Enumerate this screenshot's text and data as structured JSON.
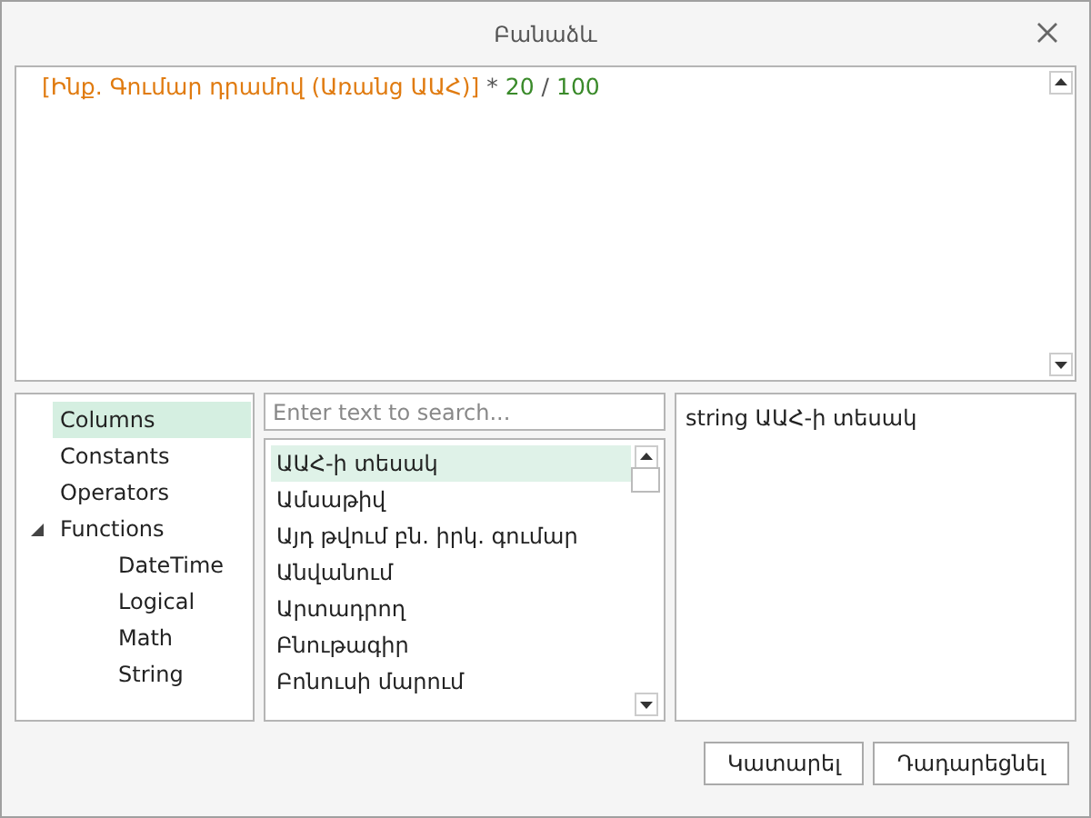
{
  "window": {
    "title": "Բանաձև"
  },
  "expression": [
    {
      "kind": "field",
      "text": "[Ինք. Գումար դրամով (Առանց ԱԱՀ)]"
    },
    {
      "kind": "operator",
      "text": "*"
    },
    {
      "kind": "number",
      "text": "20"
    },
    {
      "kind": "operator",
      "text": "/"
    },
    {
      "kind": "number",
      "text": "100"
    }
  ],
  "categories": [
    {
      "label": "Columns",
      "selected": true
    },
    {
      "label": "Constants",
      "selected": false
    },
    {
      "label": "Operators",
      "selected": false
    },
    {
      "label": "Functions",
      "selected": false,
      "expanded": true,
      "children": [
        {
          "label": "DateTime",
          "selected": false
        },
        {
          "label": "Logical",
          "selected": false
        },
        {
          "label": "Math",
          "selected": false
        },
        {
          "label": "String",
          "selected": false
        }
      ]
    }
  ],
  "search": {
    "placeholder": "Enter text to search..."
  },
  "items": [
    {
      "label": "ԱԱՀ-ի տեսակ",
      "selected": true
    },
    {
      "label": "Ամսաթիվ",
      "selected": false
    },
    {
      "label": "Այդ թվում բն. իրկ. գումար",
      "selected": false
    },
    {
      "label": "Անվանում",
      "selected": false
    },
    {
      "label": "Արտադրող",
      "selected": false
    },
    {
      "label": "Բնութագիր",
      "selected": false
    },
    {
      "label": "Բոնուսի մարում",
      "selected": false
    }
  ],
  "description": "string ԱԱՀ-ի տեսակ",
  "buttons": [
    "Կատարել",
    "Դադարեցնել"
  ]
}
